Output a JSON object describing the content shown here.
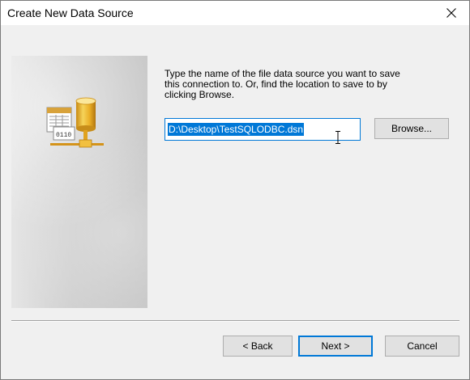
{
  "window": {
    "title": "Create New Data Source",
    "close_icon": "close-icon"
  },
  "instructions": {
    "line1": "Type the name of the file data source you want to save",
    "line2": "this connection to.  Or, find the location to save to by",
    "line3": "clicking Browse."
  },
  "path_field": {
    "value": "D:\\Desktop\\TestSQLODBC.dsn"
  },
  "buttons": {
    "browse": "Browse...",
    "back": "< Back",
    "next": "Next >",
    "cancel": "Cancel"
  },
  "graphic": {
    "icon": "data-source-icon",
    "label": "0110"
  },
  "colors": {
    "accent": "#0078d7",
    "dialog_bg": "#f0f0f0",
    "button_bg": "#e1e1e1"
  }
}
